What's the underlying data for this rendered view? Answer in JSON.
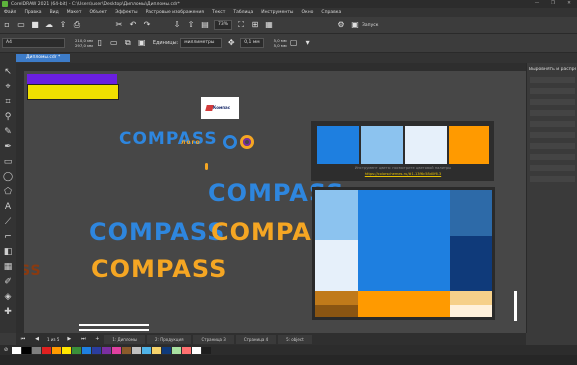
{
  "titlebar": {
    "title": "CorelDRAW 2021 (64-bit) - C:\\Users\\user\\Desktop\\Дипломы\\Дипломы.cdr*"
  },
  "window_controls": [
    "—",
    "❐",
    "✕"
  ],
  "menu": [
    "Файл",
    "Правка",
    "Вид",
    "Макет",
    "Объект",
    "Эффекты",
    "Растровые изображения",
    "Текст",
    "Таблица",
    "Инструменты",
    "Окно",
    "Справка"
  ],
  "std_toolbar": {
    "zoom": "73%",
    "launch_label": "Запуск"
  },
  "prop_bar": {
    "preset": "A4",
    "width": "210,0 мм",
    "height": "297,0 мм",
    "units_label": "Единицы:",
    "units_value": "миллиметры",
    "nudge": "0,1 мм",
    "dup_x": "5,0 мм",
    "dup_y": "5,0 мм"
  },
  "doc_tab": {
    "label": "Дипломы.cdr *"
  },
  "canvas": {
    "logo_text": "Компас",
    "compass_words": [
      "COMPASS",
      "COMPASS",
      "COMPASS",
      "COMPASS",
      "COMPASS"
    ],
    "small_caption": "лого",
    "cut_text": "SS",
    "caption": "Инструмент цвета: посмотрите цветовой палитры",
    "link": "https://colorschemes.ru/#1.13f6c58d0f6.3",
    "palette_strip": [
      "#1e7fe0",
      "#8cc3ef",
      "#e6f0fa",
      "#ff9a00"
    ]
  },
  "right_panel": {
    "title": "Выровнять и распределить"
  },
  "page_bar": {
    "page_info": "1 из 5",
    "tabs": [
      "1: Дипломы",
      "2: Продукция",
      "Страница 3",
      "Страница 4",
      "5: object"
    ]
  },
  "palette_colors": [
    "#ffffff",
    "#000000",
    "#7f7f7f",
    "#e02020",
    "#ff9a00",
    "#ffe600",
    "#3a8f3a",
    "#1e7fe0",
    "#2b3d9f",
    "#7a2ea0",
    "#e040a0",
    "#8a5a2b",
    "#c0c0c0",
    "#4fb3e8",
    "#f6d36b",
    "#0f3a7a",
    "#a8e0a0",
    "#ff7070",
    "#ffffff",
    "#1e1e1e"
  ],
  "status": {
    "text": ""
  },
  "colors": {
    "accent": "#3d7cc9",
    "compass_blue": "#2e86de",
    "compass_orange": "#f5a623"
  }
}
